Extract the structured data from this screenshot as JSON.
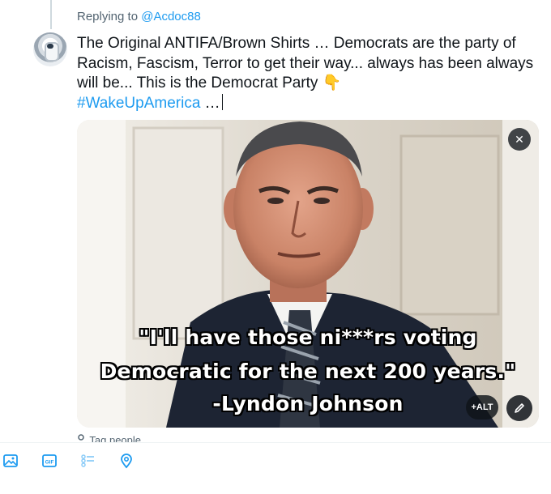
{
  "reply": {
    "prefix": "Replying to",
    "handle": "@Acdoc88"
  },
  "tweet": {
    "text": "The Original ANTIFA/Brown Shirts … Democrats are the party of Racism, Fascism, Terror to get their way... always has been always will be... This is the Democrat Party 👇",
    "hashtag": "#WakeUpAmerica",
    "trailing": " …"
  },
  "media": {
    "quote_lines": [
      "\"I'll have those ni***rs voting",
      "Democratic for the next 200 years.\"",
      "-Lyndon Johnson"
    ],
    "close_label": "✕",
    "alt_label": "+ALT"
  },
  "tag_people": {
    "label": "Tag people"
  },
  "toolbar": {
    "icons": [
      "image-icon",
      "gif-icon",
      "poll-icon",
      "location-icon"
    ],
    "gif_label": "GIF"
  },
  "colors": {
    "accent": "#1d9bf0",
    "text": "#0f1419",
    "muted": "#536471"
  }
}
